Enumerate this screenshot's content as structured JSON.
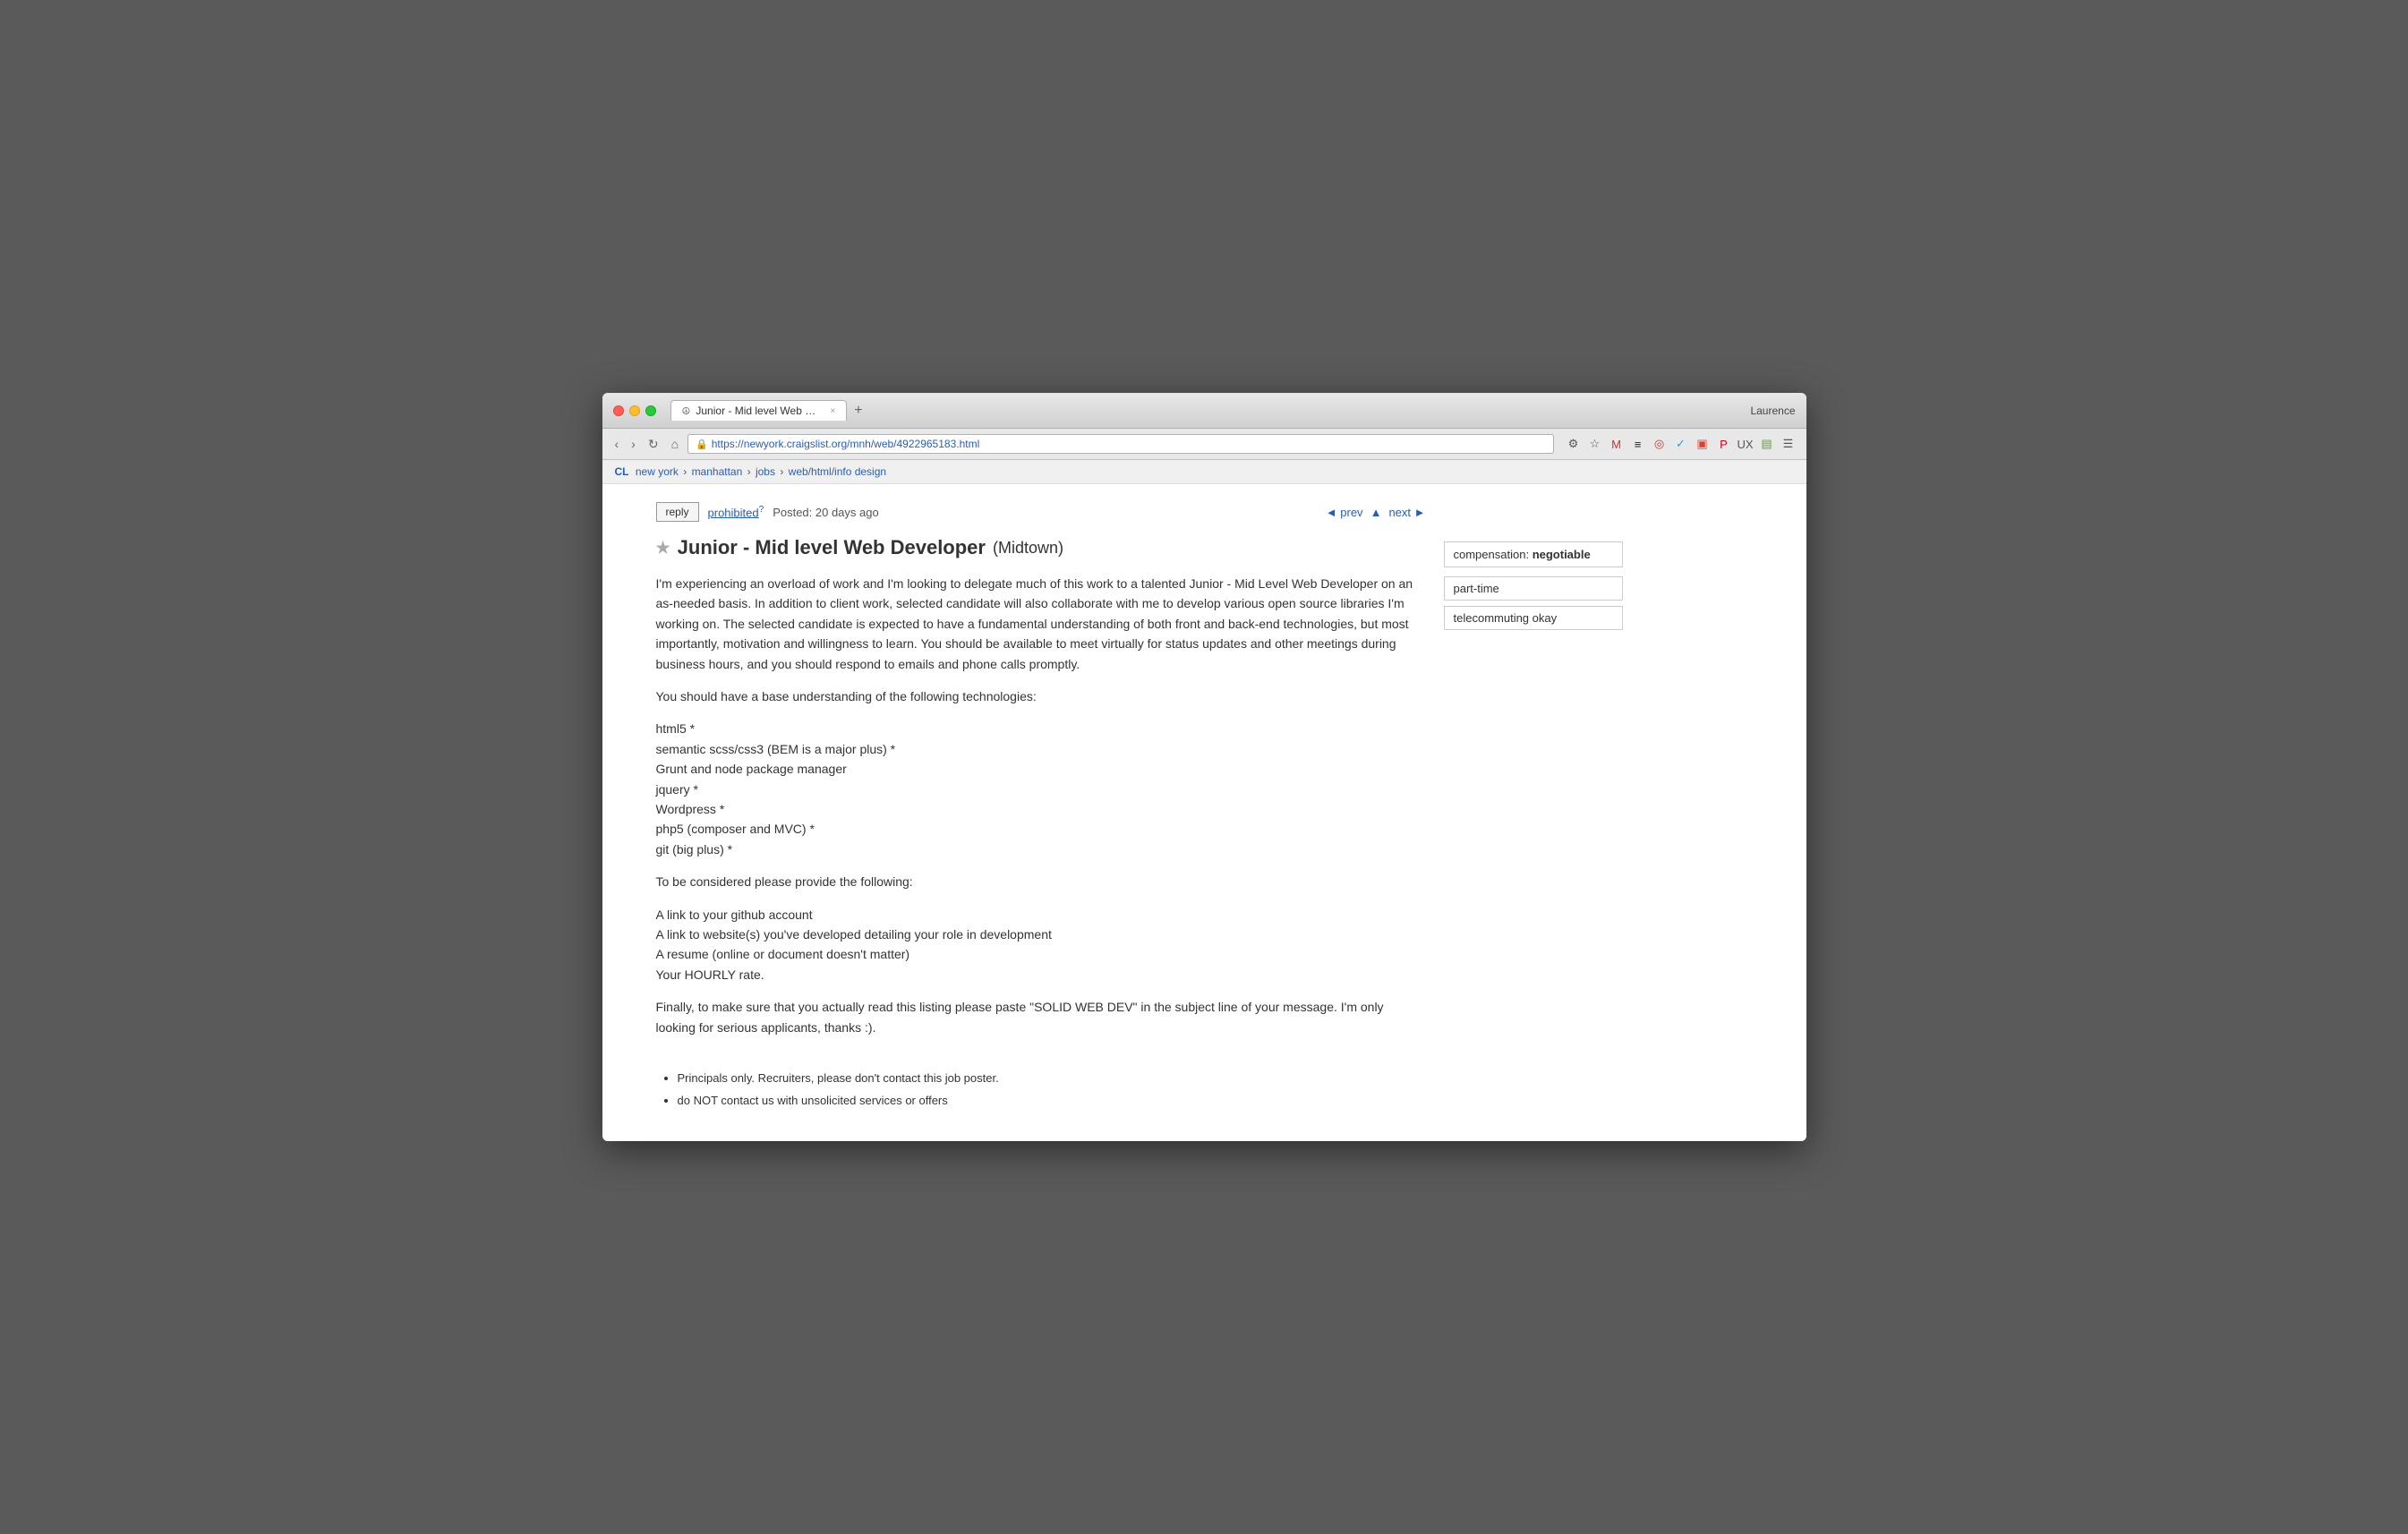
{
  "browser": {
    "traffic_lights": [
      "close",
      "minimize",
      "maximize"
    ],
    "tab": {
      "icon": "☮",
      "title": "Junior - Mid level Web Dev",
      "close_label": "×"
    },
    "new_tab_label": "+",
    "user_label": "Laurence",
    "nav": {
      "back": "‹",
      "forward": "›",
      "reload": "↻",
      "home": "⌂"
    },
    "address": "https://newyork.craigslist.org/mnh/web/4922965183.html",
    "ssl_icon": "🔒",
    "toolbar_icons": [
      "★",
      "M",
      "≡",
      "◎",
      "✓",
      "▣",
      "P",
      "UX",
      "▤",
      "☰"
    ]
  },
  "breadcrumb": {
    "cl": "CL",
    "new_york": "new york",
    "manhattan": "manhattan",
    "jobs": "jobs",
    "category": "web/html/info design",
    "sep": "›"
  },
  "post": {
    "reply_label": "reply",
    "prohibited_label": "prohibited",
    "prohibited_sup": "?",
    "posted_label": "Posted: 20 days ago",
    "prev_label": "◄ prev",
    "up_label": "▲",
    "next_label": "next ►",
    "star": "★",
    "title": "Junior - Mid level Web Developer",
    "location": "(Midtown)",
    "body_paragraphs": [
      "I'm experiencing an overload of work and I'm looking to delegate much of this work to a talented Junior - Mid Level Web Developer on an as-needed basis. In addition to client work, selected candidate will also collaborate with me to develop various open source libraries I'm working on. The selected candidate is expected to have a fundamental understanding of both front and back-end technologies, but most importantly, motivation and willingness to learn. You should be available to meet virtually for status updates and other meetings during business hours, and you should respond to emails and phone calls promptly.",
      "You should have a base understanding of the following technologies:",
      "html5 *\nsemantic scss/css3 (BEM is a major plus) *\nGrunt and node package manager\njquery *\nWordpress *\nphp5 (composer and MVC) *\ngit (big plus) *",
      "To be considered please provide the following:",
      "A link to your github account\nA link to website(s) you've developed detailing your role in development\nA resume (online or document doesn't matter)\nYour HOURLY rate.",
      "Finally, to make sure that you actually read this listing please paste \"SOLID WEB DEV\" in the subject line of your message. I'm only looking for serious applicants, thanks :)."
    ],
    "footer_bullets": [
      "Principals only. Recruiters, please don't contact this job poster.",
      "do NOT contact us with unsolicited services or offers"
    ]
  },
  "sidebar": {
    "compensation_label": "compensation:",
    "compensation_value": "negotiable",
    "tag1": "part-time",
    "tag2": "telecommuting okay"
  }
}
